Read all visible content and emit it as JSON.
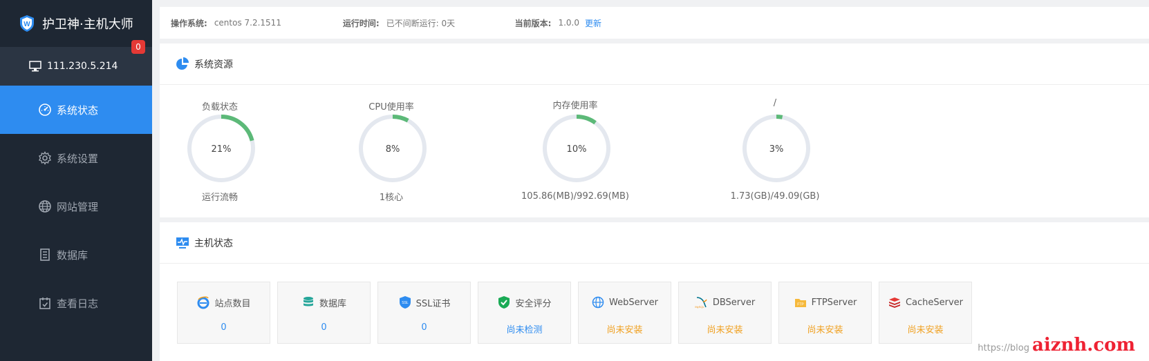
{
  "app": {
    "title": "护卫神·主机大师"
  },
  "host": {
    "ip": "111.230.5.214",
    "badge": "0"
  },
  "nav": [
    {
      "label": "系统状态",
      "icon": "dashboard-icon",
      "active": true
    },
    {
      "label": "系统设置",
      "icon": "gear-icon",
      "active": false
    },
    {
      "label": "网站管理",
      "icon": "globe-icon",
      "active": false
    },
    {
      "label": "数据库",
      "icon": "database-icon",
      "active": false
    },
    {
      "label": "查看日志",
      "icon": "calendar-check-icon",
      "active": false
    }
  ],
  "info": {
    "os_label": "操作系统:",
    "os_value": "centos 7.2.1511",
    "uptime_label": "运行时间:",
    "uptime_value": "已不间断运行: 0天",
    "version_label": "当前版本:",
    "version_value": "1.0.0",
    "update_link": "更新"
  },
  "resources": {
    "title": "系统资源",
    "gauges": [
      {
        "title": "负载状态",
        "percent": 21,
        "label": "21%",
        "sub": "运行流畅"
      },
      {
        "title": "CPU使用率",
        "percent": 8,
        "label": "8%",
        "sub": "1核心"
      },
      {
        "title": "内存使用率",
        "percent": 10,
        "label": "10%",
        "sub": "105.86(MB)/992.69(MB)"
      },
      {
        "title": "/",
        "percent": 3,
        "label": "3%",
        "sub": "1.73(GB)/49.09(GB)"
      }
    ]
  },
  "host_status": {
    "title": "主机状态",
    "cards": [
      {
        "title": "站点数目",
        "value": "0",
        "icon": "ie-icon",
        "warn": false
      },
      {
        "title": "数据库",
        "value": "0",
        "icon": "database-icon",
        "warn": false
      },
      {
        "title": "SSL证书",
        "value": "0",
        "icon": "ssl-icon",
        "warn": false
      },
      {
        "title": "安全评分",
        "value": "尚未检测",
        "icon": "shield-check-icon",
        "warn": false
      },
      {
        "title": "WebServer",
        "value": "尚未安装",
        "icon": "globe-icon",
        "warn": true
      },
      {
        "title": "DBServer",
        "value": "尚未安装",
        "icon": "mysql-icon",
        "warn": true
      },
      {
        "title": "FTPServer",
        "value": "尚未安装",
        "icon": "ftp-folder-icon",
        "warn": true
      },
      {
        "title": "CacheServer",
        "value": "尚未安装",
        "icon": "redis-icon",
        "warn": true
      }
    ]
  },
  "colors": {
    "accent": "#2e8cf0",
    "gauge": "#5cb978",
    "track": "#e4e8ef",
    "warn": "#f0a020"
  },
  "watermark": {
    "small": "https://blog",
    "big": "aiznh.com"
  }
}
